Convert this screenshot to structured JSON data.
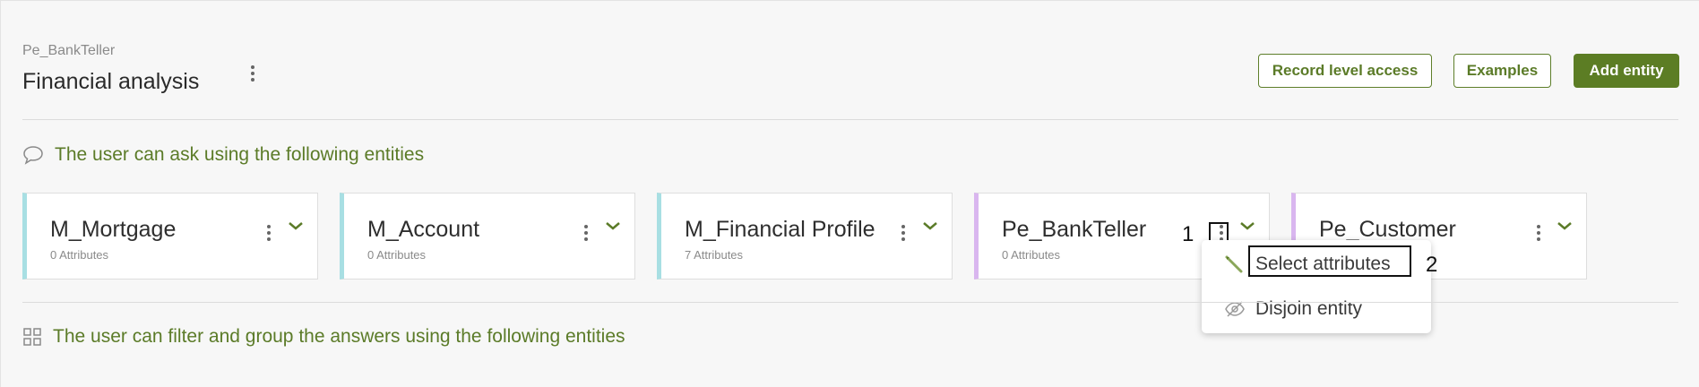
{
  "header": {
    "breadcrumb": "Pe_BankTeller",
    "title": "Financial analysis",
    "buttons": {
      "record_level_access": "Record level access",
      "examples": "Examples",
      "add_entity": "Add entity"
    }
  },
  "sections": {
    "ask": {
      "label": "The user can ask using the following entities",
      "icon": "speech-bubble-icon"
    },
    "filter": {
      "label": "The user can filter and group the answers using the following entities",
      "icon": "grid-icon"
    }
  },
  "entities": [
    {
      "name": "M_Mortgage",
      "attributes": "0 Attributes",
      "color": "#a8dfe3"
    },
    {
      "name": "M_Account",
      "attributes": "0 Attributes",
      "color": "#a8dfe3"
    },
    {
      "name": "M_Financial Profile",
      "attributes": "7 Attributes",
      "color": "#a8dfe3"
    },
    {
      "name": "Pe_BankTeller",
      "attributes": "0 Attributes",
      "color": "#d9b6ef"
    },
    {
      "name": "Pe_Customer",
      "attributes": "",
      "color": "#d9b6ef"
    }
  ],
  "menu": {
    "items": [
      {
        "label": "Select attributes",
        "icon": "pencil-icon"
      },
      {
        "label": "Disjoin entity",
        "icon": "eye-slash-icon"
      }
    ]
  },
  "annotations": {
    "step1": "1",
    "step2": "2"
  },
  "colors": {
    "accent": "#5c7d24",
    "teal": "#a8dfe3",
    "lilac": "#d9b6ef"
  }
}
